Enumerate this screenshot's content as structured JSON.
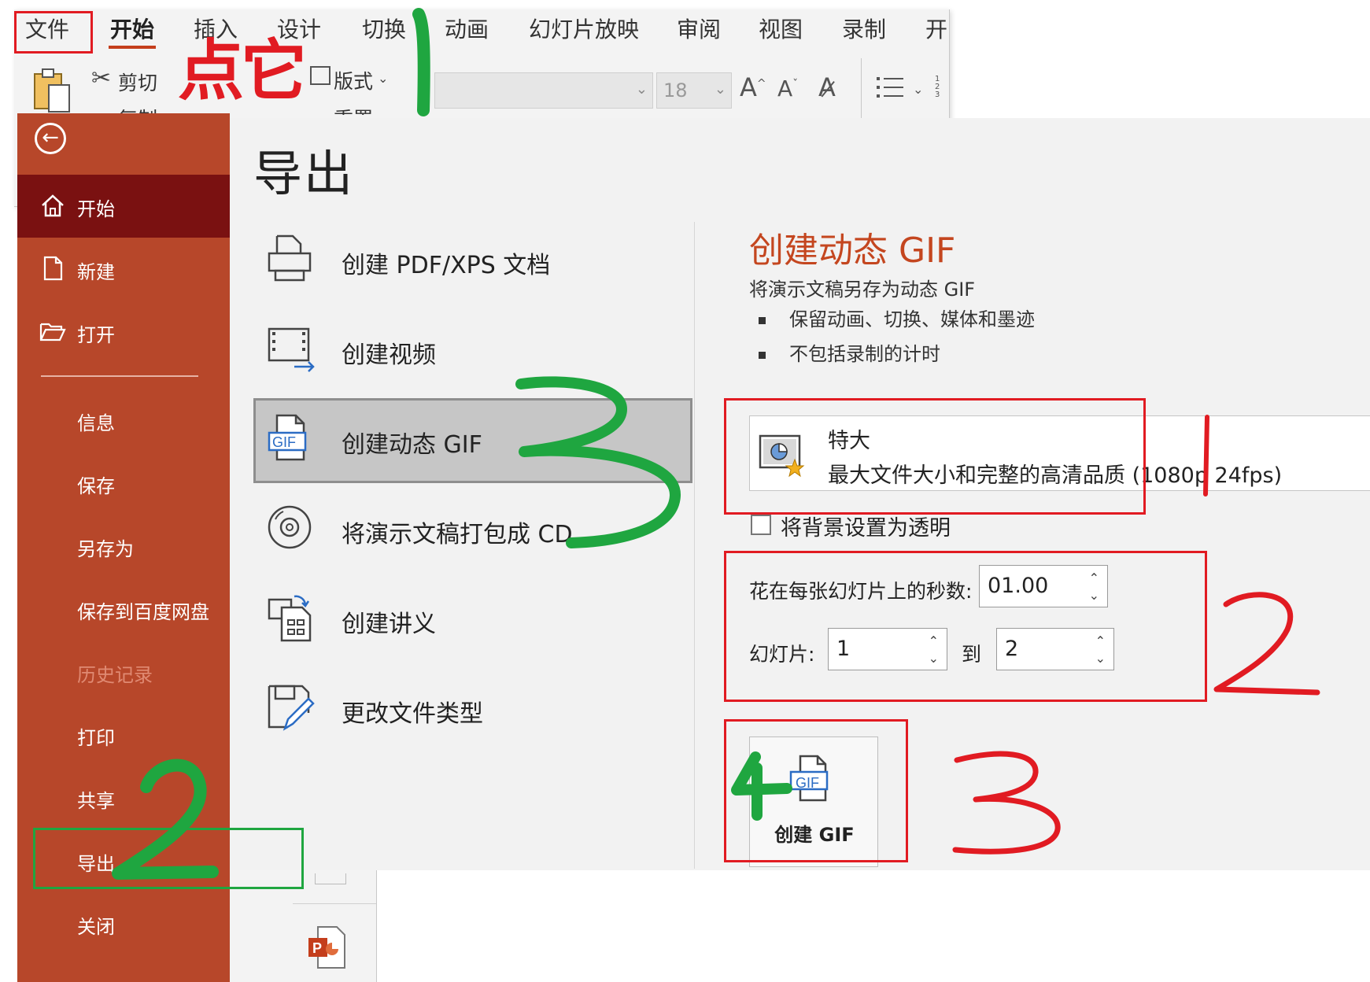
{
  "ribbon": {
    "tabs": [
      "文件",
      "开始",
      "插入",
      "设计",
      "切换",
      "动画",
      "幻灯片放映",
      "审阅",
      "视图",
      "录制",
      "开"
    ],
    "active_tab": "开始",
    "clipboard": {
      "cut": "剪切",
      "copy": "复制",
      "reset": "重置"
    },
    "layout": "版式",
    "font_size": "18"
  },
  "backstage": {
    "sidebar": {
      "items": [
        {
          "label": "开始",
          "icon": "home-icon"
        },
        {
          "label": "新建",
          "icon": "new-file-icon"
        },
        {
          "label": "打开",
          "icon": "folder-open-icon"
        },
        {
          "label": "信息"
        },
        {
          "label": "保存"
        },
        {
          "label": "另存为"
        },
        {
          "label": "保存到百度网盘"
        },
        {
          "label": "历史记录",
          "disabled": true
        },
        {
          "label": "打印"
        },
        {
          "label": "共享"
        },
        {
          "label": "导出"
        },
        {
          "label": "关闭"
        }
      ]
    },
    "page_title": "导出",
    "export_options": [
      {
        "label": "创建 PDF/XPS 文档",
        "icon": "pdf-icon"
      },
      {
        "label": "创建视频",
        "icon": "video-icon"
      },
      {
        "label": "创建动态 GIF",
        "icon": "gif-icon",
        "selected": true
      },
      {
        "label": "将演示文稿打包成 CD",
        "icon": "cd-icon"
      },
      {
        "label": "创建讲义",
        "icon": "handout-icon"
      },
      {
        "label": "更改文件类型",
        "icon": "change-type-icon"
      }
    ],
    "detail": {
      "title": "创建动态 GIF",
      "description": "将演示文稿另存为动态 GIF",
      "bullets": [
        "保留动画、切换、媒体和墨迹",
        "不包括录制的计时"
      ],
      "quality": {
        "title": "特大",
        "detail": "最大文件大小和完整的高清品质 (1080p 24fps)"
      },
      "transparent_label": "将背景设置为透明",
      "seconds_label": "花在每张幻灯片上的秒数:",
      "seconds_value": "01.00",
      "slides_label": "幻灯片:",
      "slides_from": "1",
      "to_label": "到",
      "slides_to": "2",
      "create_button": "创建 GIF",
      "gif_badge": "GIF"
    }
  },
  "annotations": {
    "point_it": "点它",
    "red_color": "#e11b22",
    "green_color": "#1fa640"
  }
}
